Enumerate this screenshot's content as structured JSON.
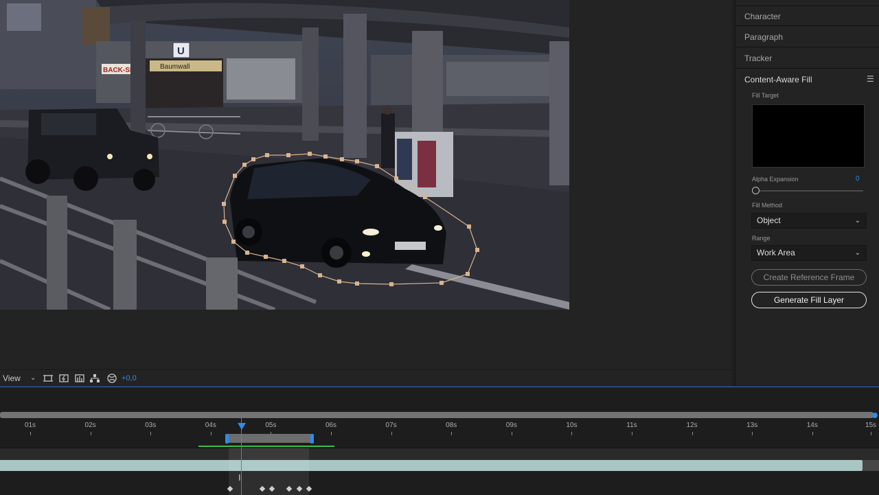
{
  "panel": {
    "tabs": [
      "Character",
      "Paragraph",
      "Tracker"
    ],
    "caf": {
      "title": "Content-Aware Fill",
      "menu_icon": "hamburger-menu-icon",
      "fill_target_label": "Fill Target",
      "alpha_expansion_label": "Alpha Expansion",
      "alpha_expansion_value": "0",
      "fill_method_label": "Fill Method",
      "fill_method_value": "Object",
      "range_label": "Range",
      "range_value": "Work Area",
      "create_reference_label": "Create Reference Frame",
      "generate_label": "Generate Fill Layer"
    }
  },
  "toolbar": {
    "view_label": "View",
    "exposure_value": "+0,0",
    "icons": [
      "region-of-interest-icon",
      "snapshot-icon",
      "channel-icon",
      "flowchart-icon",
      "reset-exposure-icon"
    ]
  },
  "timeline": {
    "ticks": [
      "01s",
      "02s",
      "03s",
      "04s",
      "05s",
      "06s",
      "07s",
      "08s",
      "09s",
      "10s",
      "11s",
      "12s",
      "13s",
      "14s",
      "15s"
    ],
    "playhead_seconds": 4.5
  },
  "viewer": {
    "signs": {
      "back_shop": "BACK-SH",
      "baumwall": "Baumwall",
      "u_sign": "U"
    }
  },
  "colors": {
    "accent_blue": "#2d8ceb",
    "layer_teal": "#a9c6c4",
    "mask_tan": "#d9b48f",
    "panel_bg": "#232323"
  }
}
